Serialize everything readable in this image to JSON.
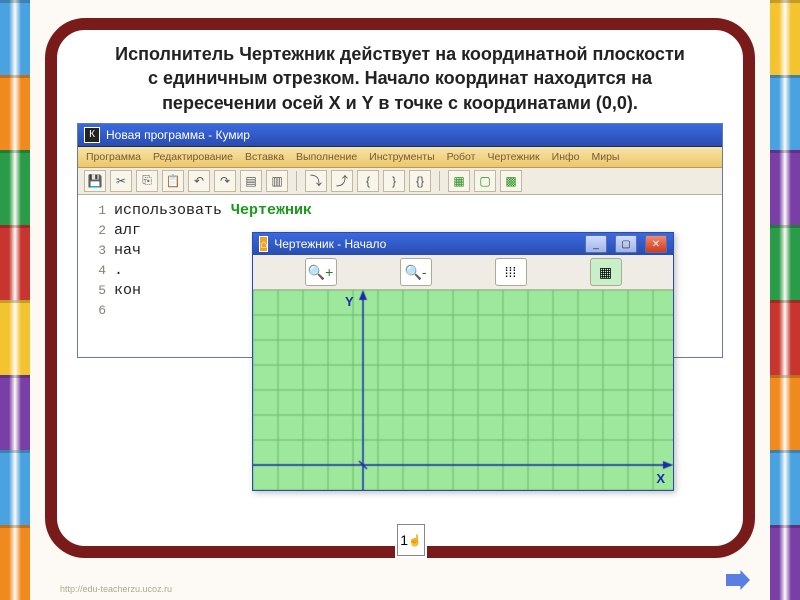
{
  "slide": {
    "title_l1": "Исполнитель Чертежник действует на координатной плоскости",
    "title_l2": "с единичным отрезком. Начало координат находится на",
    "title_l3": "пересечении осей X и Y  в точке с координатами (0,0).",
    "footer_link": "http://edu-teacherzu.ucoz.ru",
    "cursor_label": "1"
  },
  "app": {
    "title_prefix": "К",
    "title": "Новая программа - Кумир",
    "menu": [
      "Программа",
      "Редактирование",
      "Вставка",
      "Выполнение",
      "Инструменты",
      "Робот",
      "Чертежник",
      "Инфо",
      "Миры"
    ]
  },
  "code": {
    "lines": [
      {
        "n": "1",
        "plain": "использовать ",
        "green": "Чертежник"
      },
      {
        "n": "2",
        "plain": "алг",
        "green": ""
      },
      {
        "n": "3",
        "plain": "нач",
        "green": ""
      },
      {
        "n": "4",
        "plain": ".",
        "green": ""
      },
      {
        "n": "5",
        "plain": "кон",
        "green": ""
      },
      {
        "n": "6",
        "plain": "",
        "green": ""
      }
    ]
  },
  "drafts": {
    "title": "Чертежник - Начало",
    "y_label": "Y",
    "x_label": "X"
  },
  "crayon_colors_left": [
    "#4aa3e0",
    "#f08a1f",
    "#2a9b48",
    "#c7352e",
    "#f4c430",
    "#7a3fa6",
    "#4aa3e0",
    "#f08a1f"
  ],
  "crayon_colors_right": [
    "#f4c430",
    "#4aa3e0",
    "#7a3fa6",
    "#2a9b48",
    "#c7352e",
    "#f08a1f",
    "#4aa3e0",
    "#7a3fa6"
  ]
}
